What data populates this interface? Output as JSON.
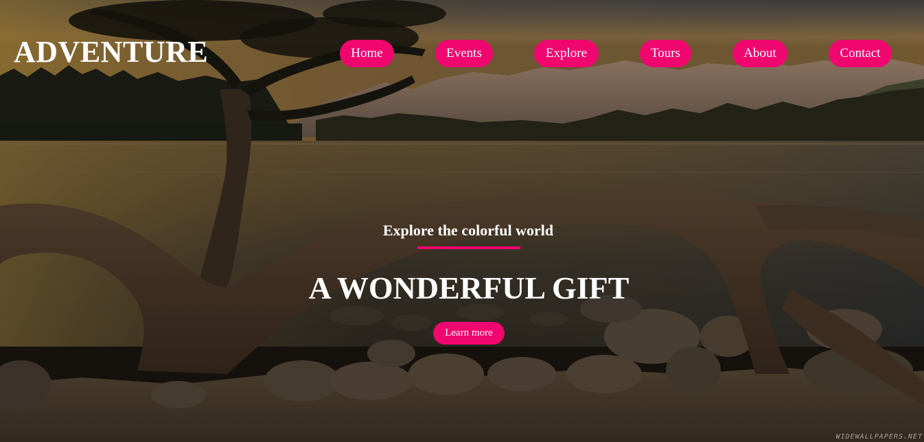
{
  "site": {
    "logo": "ADVENTURE"
  },
  "nav": {
    "items": [
      {
        "label": "Home"
      },
      {
        "label": "Events"
      },
      {
        "label": "Explore"
      },
      {
        "label": "Tours"
      },
      {
        "label": "About"
      },
      {
        "label": "Contact"
      }
    ]
  },
  "hero": {
    "subtitle": "Explore the colorful world",
    "headline": "A WONDERFUL GIFT",
    "cta_label": "Learn more",
    "watermark": "WIDEWALLPAPERS.NET"
  },
  "colors": {
    "accent": "#f0066f",
    "text": "#ffffff"
  }
}
